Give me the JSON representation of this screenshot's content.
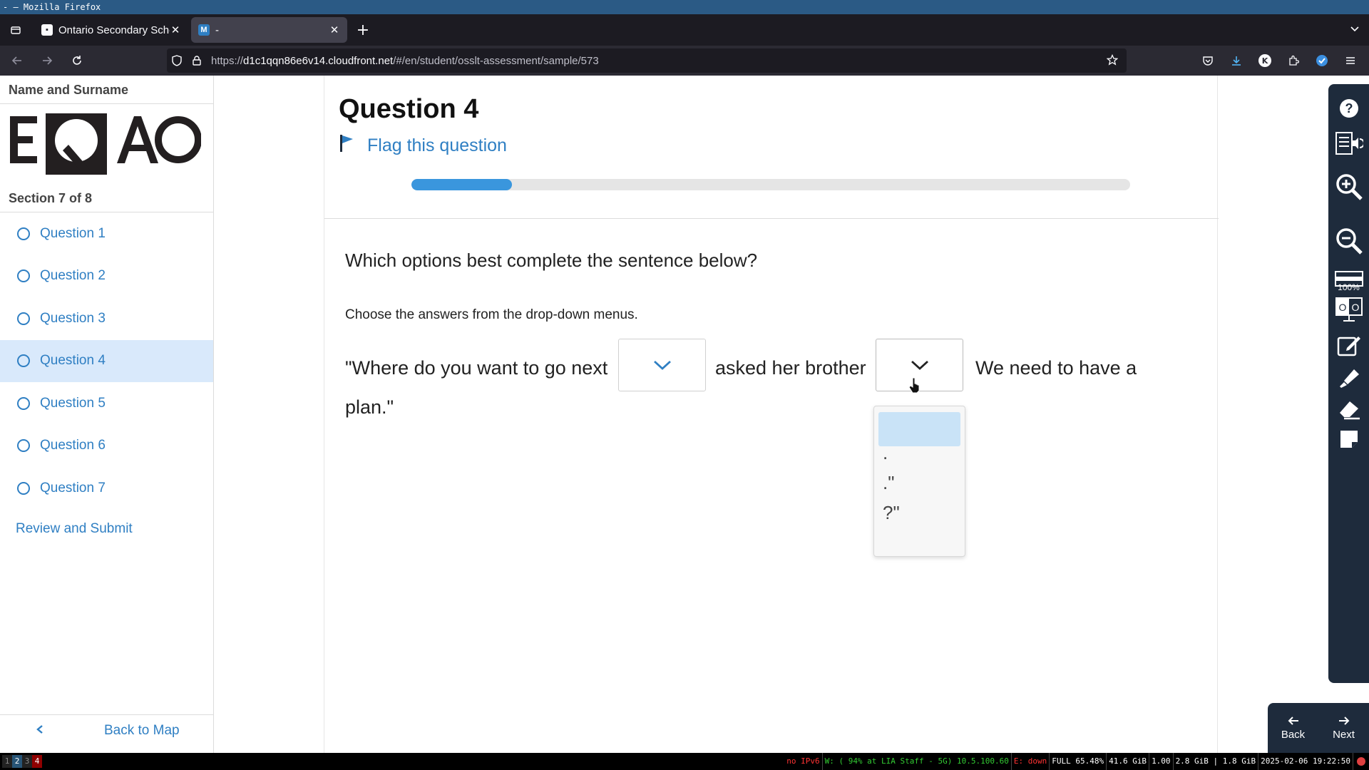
{
  "window": {
    "title": "- — Mozilla Firefox"
  },
  "browser": {
    "tabs": [
      {
        "title": "Ontario Secondary School",
        "active": false
      },
      {
        "title": "-",
        "active": true
      }
    ],
    "url_prefix": "https://",
    "url_host": "d1c1qqn86e6v14.cloudfront.net",
    "url_rest": "/#/en/student/osslt-assessment/sample/573"
  },
  "sidebar": {
    "student_name": "Name and Surname",
    "logo_text": "EQAO",
    "section_label": "Section 7 of 8",
    "questions": [
      {
        "label": "Question 1"
      },
      {
        "label": "Question 2"
      },
      {
        "label": "Question 3"
      },
      {
        "label": "Question 4"
      },
      {
        "label": "Question 5"
      },
      {
        "label": "Question 6"
      },
      {
        "label": "Question 7"
      }
    ],
    "active_question_index": 3,
    "review_label": "Review and Submit",
    "back_to_map_label": "Back to Map"
  },
  "main": {
    "question_title": "Question 4",
    "flag_label": "Flag this question",
    "progress_fraction": 0.14,
    "prompt": "Which options best complete the sentence below?",
    "instruction": "Choose the answers from the drop-down menus.",
    "sentence_parts": [
      "\"Where do you want to go next",
      "asked her brother",
      "We need to have a",
      "plan.\""
    ],
    "dropdown_options": [
      "",
      ".",
      ".\"",
      "?\""
    ]
  },
  "tools": {
    "zoom_level": "100%",
    "icons": [
      "help-icon",
      "text-to-speech-icon",
      "zoom-in-icon",
      "zoom-out-icon",
      "line-reader-icon",
      "color-contrast-icon",
      "notepad-icon",
      "highlighter-icon",
      "eraser-icon",
      "sticky-note-icon"
    ]
  },
  "bottom_nav": {
    "back_label": "Back",
    "next_label": "Next"
  },
  "statusbar": {
    "workspaces": [
      "1",
      "2",
      "3",
      "4"
    ],
    "focused_workspace": "2",
    "urgent_workspace": "4",
    "items": [
      {
        "text": "no IPv6",
        "color": "red"
      },
      {
        "text": "W: ( 94% at LIA Staff - 5G) 10.5.100.60",
        "color": "green"
      },
      {
        "text": "E: down",
        "color": "red"
      },
      {
        "text": "FULL 65.48%",
        "color": "white"
      },
      {
        "text": "41.6 GiB",
        "color": "white"
      },
      {
        "text": "1.00",
        "color": "white"
      },
      {
        "text": "2.8 GiB | 1.8 GiB",
        "color": "white"
      },
      {
        "text": "2025-02-06 19:22:50",
        "color": "white"
      }
    ]
  },
  "colors": {
    "accent_blue": "#2f7fc3",
    "progress_blue": "#3a96dd",
    "active_question_bg": "#d9e9fb",
    "tool_panel_bg": "#1e2b3c"
  }
}
